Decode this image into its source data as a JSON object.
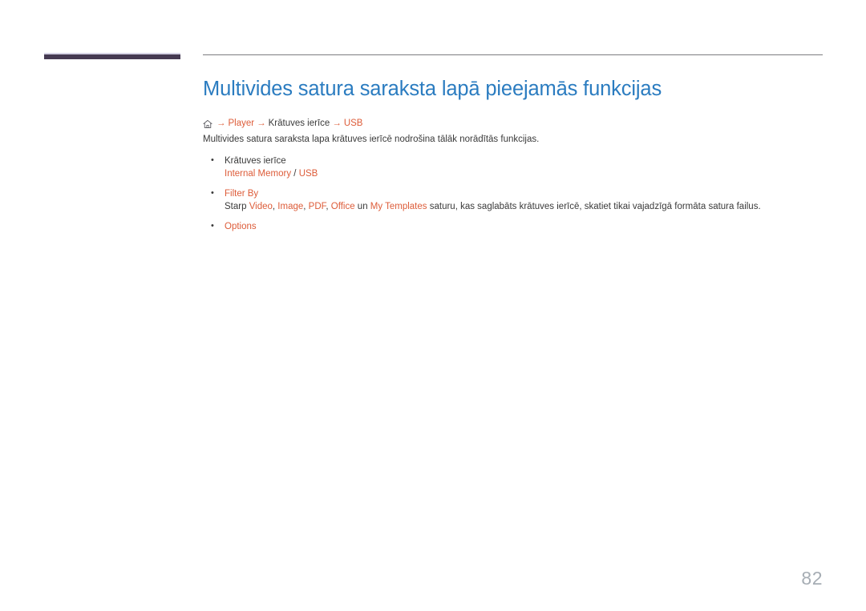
{
  "page": {
    "number": "82",
    "title": "Multivides satura saraksta lapā pieejamās funkcijas"
  },
  "breadcrumb": {
    "home_icon": "home-icon",
    "arrow": "→",
    "items": [
      {
        "label": "Player",
        "accent": true
      },
      {
        "label": "Krātuves ierīce",
        "accent": false
      },
      {
        "label": "USB",
        "accent": true
      }
    ]
  },
  "intro": "Multivides satura saraksta lapa krātuves ierīcē nodrošina tālāk norādītās funkcijas.",
  "bullets": [
    {
      "heading": "Krātuves ierīce",
      "heading_accent": false,
      "sub_parts": [
        {
          "text": "Internal Memory",
          "accent": true
        },
        {
          "text": " / ",
          "accent": false
        },
        {
          "text": "USB",
          "accent": true
        }
      ]
    },
    {
      "heading": "Filter By",
      "heading_accent": true,
      "sub_parts": [
        {
          "text": "Starp ",
          "accent": false
        },
        {
          "text": "Video",
          "accent": true
        },
        {
          "text": ", ",
          "accent": false
        },
        {
          "text": "Image",
          "accent": true
        },
        {
          "text": ", ",
          "accent": false
        },
        {
          "text": "PDF",
          "accent": true
        },
        {
          "text": ", ",
          "accent": false
        },
        {
          "text": "Office",
          "accent": true
        },
        {
          "text": " un ",
          "accent": false
        },
        {
          "text": "My Templates",
          "accent": true
        },
        {
          "text": " saturu, kas saglabāts krātuves ierīcē, skatiet tikai vajadzīgā formāta satura failus.",
          "accent": false
        }
      ]
    },
    {
      "heading": "Options",
      "heading_accent": true,
      "sub_parts": []
    }
  ],
  "colors": {
    "title_blue": "#2b7cc0",
    "accent_orange": "#dd5c39",
    "body_text": "#3a3a3a",
    "rule_gray": "#7c7c80",
    "bar_purple": "#453a52",
    "bar_highlight": "#d6d4e6",
    "page_number_gray": "#a6adb4"
  }
}
